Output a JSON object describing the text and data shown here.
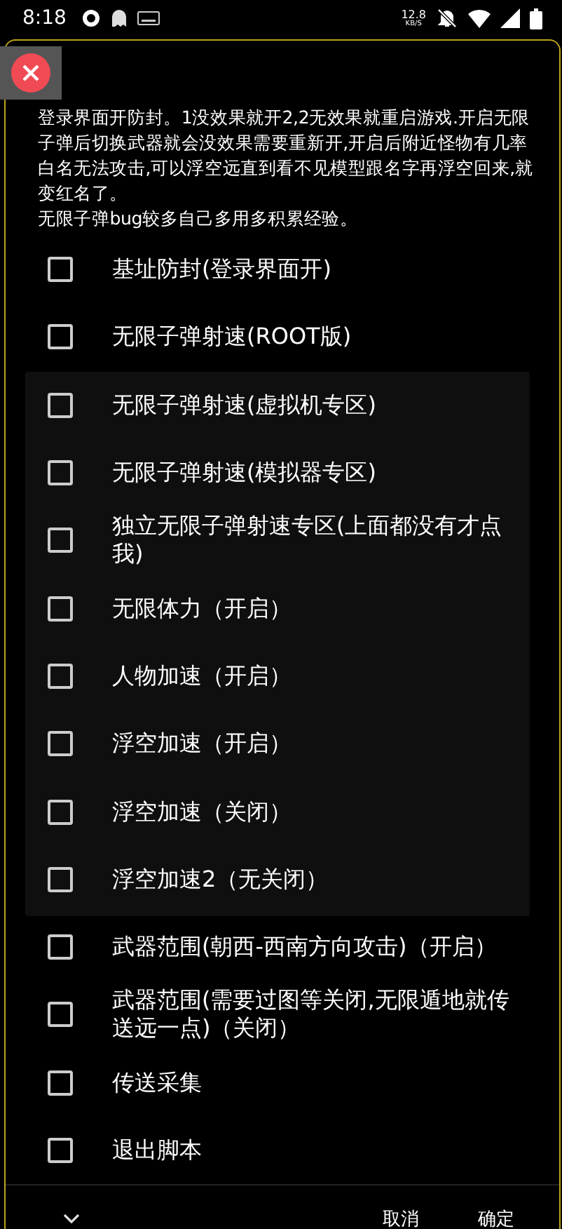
{
  "status_bar": {
    "time": "8:18",
    "net_speed": "12.8",
    "net_unit": "KB/S"
  },
  "dialog": {
    "description": [
      "登录界面开防封。1没效果就开2,2无效果就重启游戏.开启无限子弹后切换武器就会没效果需要重新开,开启后附近怪物有几率白名无法攻击,可以浮空远直到看不见模型跟名字再浮空回来,就变红名了。",
      "无限子弹bug较多自己多用多积累经验。"
    ],
    "options": [
      {
        "label": "基址防封(登录界面开)",
        "checked": false
      },
      {
        "label": "无限子弹射速(ROOT版)",
        "checked": false
      },
      {
        "label": "无限子弹射速(虚拟机专区)",
        "checked": false
      },
      {
        "label": "无限子弹射速(模拟器专区)",
        "checked": false
      },
      {
        "label": "独立无限子弹射速专区(上面都没有才点我)",
        "checked": false
      },
      {
        "label": "无限体力（开启）",
        "checked": false
      },
      {
        "label": "人物加速（开启）",
        "checked": false
      },
      {
        "label": "浮空加速（开启）",
        "checked": false
      },
      {
        "label": "浮空加速（关闭）",
        "checked": false
      },
      {
        "label": "浮空加速2（无关闭）",
        "checked": false
      },
      {
        "label": "武器范围(朝西-西南方向攻击)（开启）",
        "checked": false
      },
      {
        "label": "武器范围(需要过图等关闭,无限遁地就传送远一点)（关闭）",
        "checked": false
      },
      {
        "label": "传送采集",
        "checked": false
      },
      {
        "label": "退出脚本",
        "checked": false
      }
    ],
    "buttons": [
      "取消",
      "确定"
    ]
  }
}
